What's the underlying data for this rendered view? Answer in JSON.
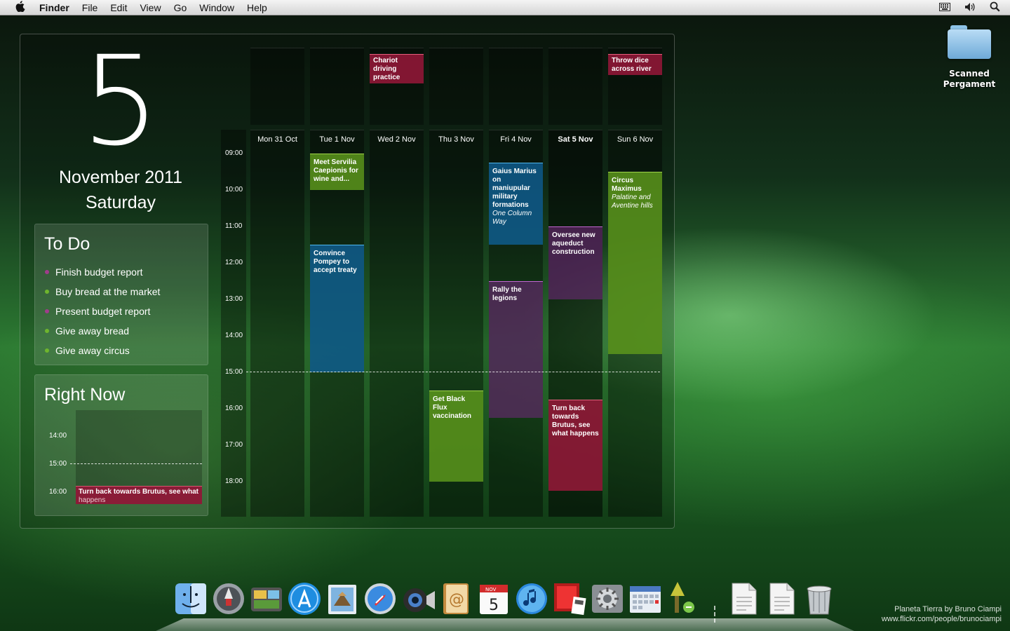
{
  "menubar": {
    "apple": "",
    "app_name": "Finder",
    "items": [
      "File",
      "Edit",
      "View",
      "Go",
      "Window",
      "Help"
    ],
    "status_icons": [
      "keyboard-icon",
      "volume-icon",
      "spotlight-icon"
    ]
  },
  "desktop": {
    "folder_label": "Scanned Pergament",
    "credit_line1": "Planeta Tierra by Bruno Ciampi",
    "credit_line2": "www.flickr.com/people/brunociampi"
  },
  "calendar": {
    "big_day": "5",
    "month_year": "November 2011",
    "weekday": "Saturday",
    "todo": {
      "title": "To Do",
      "items": [
        {
          "text": "Finish budget report",
          "color": "#a03c8c"
        },
        {
          "text": "Buy bread at the market",
          "color": "#6fb52d"
        },
        {
          "text": "Present budget report",
          "color": "#a03c8c"
        },
        {
          "text": "Give away bread",
          "color": "#6fb52d"
        },
        {
          "text": "Give away circus",
          "color": "#6fb52d"
        }
      ]
    },
    "right_now": {
      "title": "Right Now",
      "times": [
        "14:00",
        "15:00",
        "16:00"
      ],
      "event_title": "Turn back towards Brutus, see what",
      "event_rest": "happens"
    },
    "times": [
      "09:00",
      "10:00",
      "11:00",
      "12:00",
      "13:00",
      "14:00",
      "15:00",
      "16:00",
      "17:00",
      "18:00"
    ],
    "days": [
      {
        "label": "Mon 31 Oct",
        "today": false
      },
      {
        "label": "Tue 1 Nov",
        "today": false
      },
      {
        "label": "Wed 2 Nov",
        "today": false
      },
      {
        "label": "Thu 3 Nov",
        "today": false
      },
      {
        "label": "Fri 4 Nov",
        "today": false
      },
      {
        "label": "Sat 5 Nov",
        "today": true
      },
      {
        "label": "Sun 6 Nov",
        "today": false
      }
    ],
    "allday_events": [
      {
        "day": 2,
        "title": "Chariot driving practice",
        "color": "red"
      },
      {
        "day": 6,
        "title": "Throw dice across river",
        "color": "red"
      }
    ],
    "events": [
      {
        "day": 1,
        "start": "09:00",
        "end": "10:00",
        "title": "Meet Servilia Caepionis for wine and...",
        "location": "",
        "color": "green"
      },
      {
        "day": 1,
        "start": "11:30",
        "end": "15:00",
        "title": "Convince Pompey to accept treaty",
        "location": "",
        "color": "blue"
      },
      {
        "day": 3,
        "start": "15:30",
        "end": "18:00",
        "title": "Get Black Flux vaccination",
        "location": "",
        "color": "green"
      },
      {
        "day": 4,
        "start": "09:15",
        "end": "11:30",
        "title": "Gaius Marius on maniupular military formations",
        "location": "One Column Way",
        "color": "blue"
      },
      {
        "day": 4,
        "start": "12:30",
        "end": "16:15",
        "title": "Rally the legions",
        "location": "",
        "color": "purple"
      },
      {
        "day": 5,
        "start": "11:00",
        "end": "13:00",
        "title": "Oversee new aqueduct construction",
        "location": "",
        "color": "purple"
      },
      {
        "day": 5,
        "start": "15:45",
        "end": "18:15",
        "title": "Turn back towards Brutus, see what happens",
        "location": "",
        "color": "red"
      },
      {
        "day": 6,
        "start": "09:30",
        "end": "14:30",
        "title": "Circus Maximus",
        "location": "Palatine and Aventine hills",
        "color": "green"
      }
    ],
    "now": "15:00"
  },
  "dock": {
    "apps": [
      "finder-icon",
      "launchpad-icon",
      "image-capture-icon",
      "app-store-icon",
      "mail-icon",
      "safari-icon",
      "facetime-icon",
      "address-book-icon",
      "calendar-icon",
      "itunes-icon",
      "photo-booth-icon",
      "system-preferences-icon",
      "calendar-widget-icon",
      "preview-icon"
    ],
    "calendar_month": "NOV",
    "calendar_day": "5",
    "docs": [
      "document-icon",
      "document-icon"
    ],
    "trash": "trash-icon"
  }
}
